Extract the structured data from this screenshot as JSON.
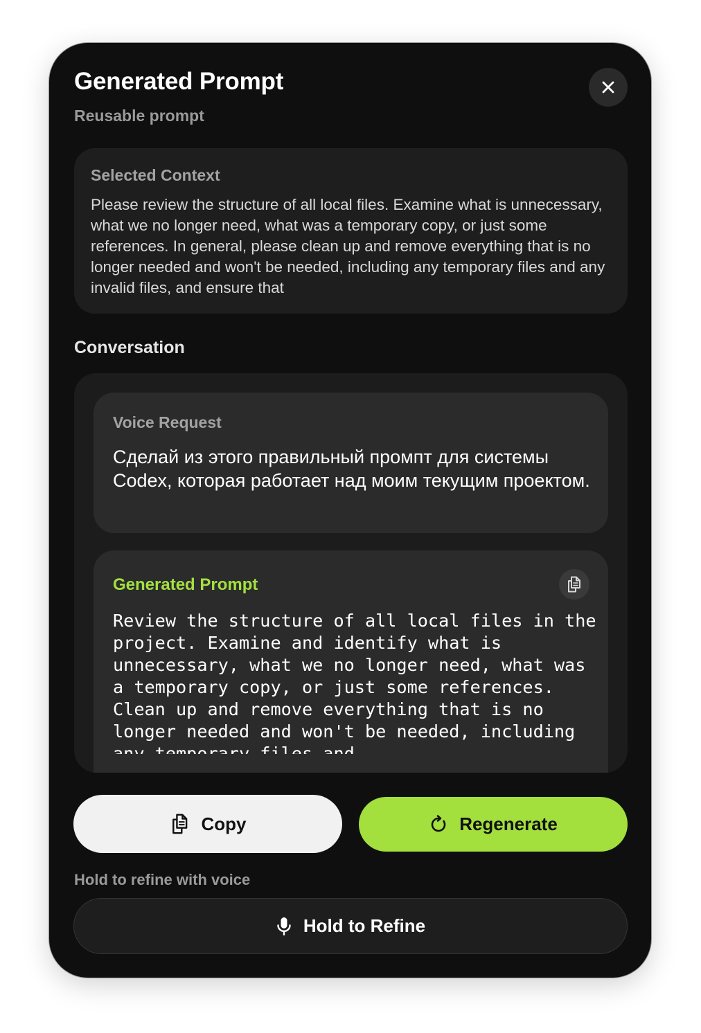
{
  "header": {
    "title": "Generated Prompt",
    "subtitle": "Reusable prompt",
    "close_icon": "close-icon"
  },
  "context": {
    "label": "Selected Context",
    "text": "Please review the structure of all local files. Examine what is unnecessary, what we no longer need, what was a temporary copy, or just some references. In general, please clean up and remove everything that is no longer needed and won't be needed, including any temporary files and any invalid files, and ensure that"
  },
  "conversation": {
    "heading": "Conversation",
    "voice_request": {
      "label": "Voice Request",
      "text": "Сделай из этого правильный промпт для системы Codex, которая работает над моим текущим проектом."
    },
    "generated_prompt": {
      "label": "Generated Prompt",
      "label_color": "#a3e13f",
      "copy_icon": "copy-icon",
      "text": "Review the structure of all local files in the project. Examine and identify what is unnecessary, what we no longer need, what was a temporary copy, or just some references. Clean up and remove everything that is no longer needed and won't be needed, including any temporary files and"
    }
  },
  "actions": {
    "copy_label": "Copy",
    "copy_icon": "copy-icon",
    "regenerate_label": "Regenerate",
    "regenerate_icon": "refresh-icon",
    "accent_color": "#a3df3d"
  },
  "refine": {
    "hint": "Hold to refine with voice",
    "button_label": "Hold to Refine",
    "mic_icon": "microphone-icon"
  }
}
